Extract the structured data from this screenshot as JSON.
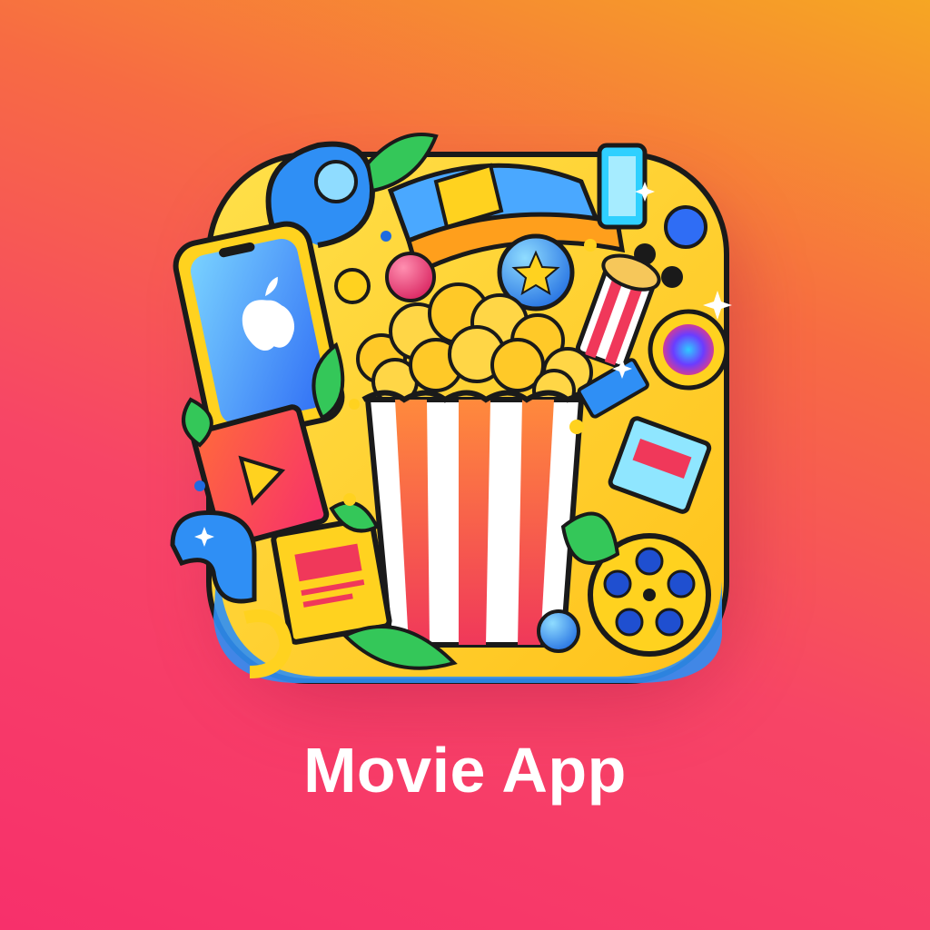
{
  "home_screen": {
    "app_icon": {
      "label": "Movie App",
      "icon": "popcorn-bucket-icon",
      "elements": [
        "smartphone-icon",
        "apple-logo-icon",
        "play-card-icon",
        "ticket-icon",
        "film-reel-icon",
        "star-badge-icon",
        "film-strip-icon",
        "drink-cup-icon",
        "leaf-icon"
      ]
    }
  },
  "colors": {
    "background_top": "#f6a623",
    "background_mid": "#f76b43",
    "background_bottom": "#f7306b",
    "icon_base": "#ffd21f",
    "popcorn": "#ffc928",
    "stripe_red": "#f0385a",
    "stripe_white": "#ffffff",
    "accent_blue": "#2f8ff5",
    "leaf_green": "#34c759",
    "label_text": "#ffffff"
  }
}
